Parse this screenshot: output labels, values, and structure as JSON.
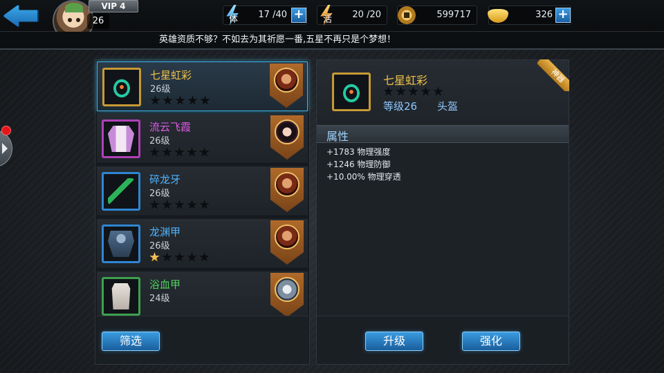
{
  "player": {
    "level": "26",
    "vip": "VIP 4"
  },
  "resources": {
    "stamina": {
      "label": "体",
      "value": "17 /40"
    },
    "energy": {
      "label": "活",
      "value": "20 /20"
    },
    "coins": {
      "value": "599717"
    },
    "gold": {
      "value": "326"
    }
  },
  "marquee": "英雄资质不够？不如去为其祈愿一番,五星不再只是个梦想！",
  "equipment_list": [
    {
      "name": "七星虹彩",
      "level": "26级",
      "stars": 0,
      "quality": "gold"
    },
    {
      "name": "流云飞霞",
      "level": "26级",
      "stars": 0,
      "quality": "purple"
    },
    {
      "name": "碎龙牙",
      "level": "26级",
      "stars": 0,
      "quality": "blue"
    },
    {
      "name": "龙渊甲",
      "level": "26级",
      "stars": 1,
      "quality": "blue"
    },
    {
      "name": "浴血甲",
      "level": "24级",
      "stars": 0,
      "quality": "green"
    }
  ],
  "filter_button": "筛选",
  "detail": {
    "name": "七星虹彩",
    "stars": 0,
    "level": "等级26",
    "slot": "头盔",
    "ribbon": "神器",
    "attr_title": "属性",
    "attributes": [
      "+1783 物理强度",
      "+1246 物理防御",
      "+10.00% 物理穿透"
    ]
  },
  "buttons": {
    "upgrade": "升级",
    "enhance": "强化"
  },
  "colors": {
    "accent_blue": "#3fb3e3",
    "quality_gold": "#f0c24a",
    "quality_purple": "#e05ae8",
    "quality_blue": "#4fb3ff",
    "quality_green": "#4fd05a"
  }
}
